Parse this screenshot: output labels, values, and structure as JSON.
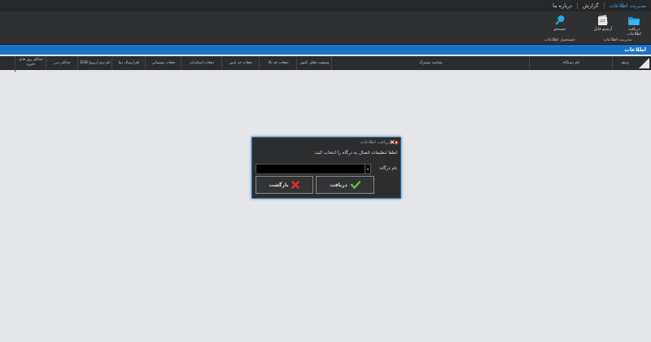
{
  "menu": {
    "items": [
      {
        "label": "مدیریت اطلاعات",
        "active": true
      },
      {
        "label": "گزارش",
        "active": false
      },
      {
        "label": "درباره ما",
        "active": false
      }
    ]
  },
  "ribbon": {
    "group_data": {
      "receive_label": "دریافت اطلاعات",
      "archive_label": "آرشیو فایل",
      "caption": "مدیریت اطلاعات"
    },
    "group_search": {
      "search_label": "جستجو",
      "caption": "جستجوی اطلاعات"
    }
  },
  "title_strip": {
    "title": "اطلاعات"
  },
  "table": {
    "columns": [
      "ردیف",
      "نام دستگاه",
      "شناسه مشترک",
      "وضعیت فعلی کنتور",
      "دفعات حد بالا",
      "دفعات حد پایین",
      "دفعات استاندارد",
      "دفعات پشتیبانی",
      "نام ارسال دیتا",
      "نام نرم (ریزو) EOB",
      "حداکثر دبی",
      "حداکثر روز قابل ذخیره"
    ]
  },
  "dialog": {
    "title": "دریافت اطلاعات",
    "close_glyph": "×",
    "message": "لطفا تنظیمات اتصال به درگاه را انتخاب کنید:",
    "port_label": "نام درگاه:",
    "port_value": "",
    "arrow_glyph": "▾",
    "receive_button": "دریافت",
    "back_button": "بازگشت"
  },
  "colors": {
    "accent": "#1c73c5",
    "background": "#e4e6ea",
    "toolbar": "#2f3032",
    "ok_green": "#5cc23a",
    "cancel_red": "#e03030"
  }
}
